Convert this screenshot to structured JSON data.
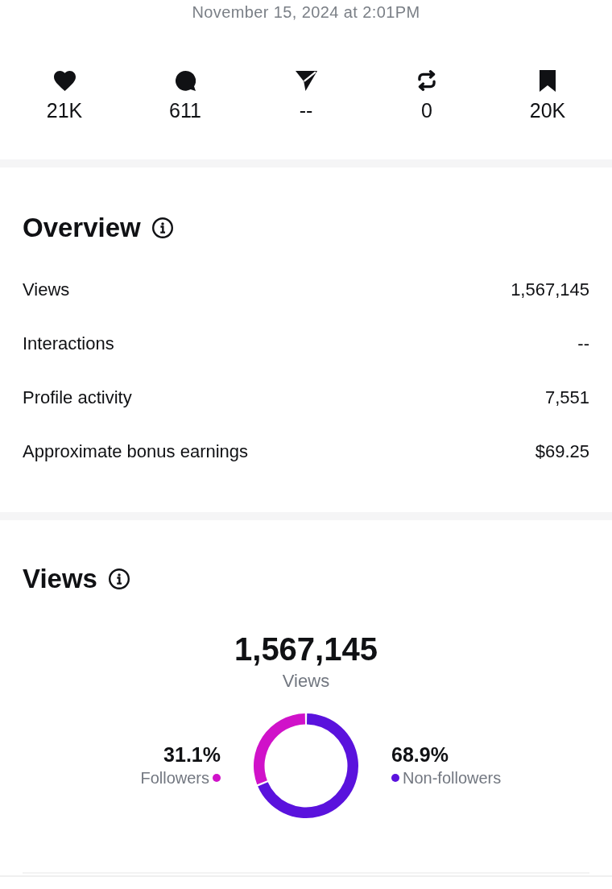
{
  "post": {
    "timestamp": "November 15, 2024 at 2:01PM"
  },
  "stats": [
    {
      "kind": "likes",
      "count": "21K"
    },
    {
      "kind": "replies",
      "count": "611"
    },
    {
      "kind": "shares",
      "count": "--"
    },
    {
      "kind": "reposts",
      "count": "0"
    },
    {
      "kind": "saves",
      "count": "20K"
    }
  ],
  "overview": {
    "title": "Overview",
    "rows": [
      {
        "label": "Views",
        "value": "1,567,145"
      },
      {
        "label": "Interactions",
        "value": "--"
      },
      {
        "label": "Profile activity",
        "value": "7,551"
      },
      {
        "label": "Approximate bonus earnings",
        "value": "$69.25"
      }
    ]
  },
  "views": {
    "title": "Views",
    "total": "1,567,145",
    "total_label": "Views",
    "chart_data": {
      "type": "donut",
      "categories": [
        "Followers",
        "Non-followers"
      ],
      "values": [
        31.1,
        68.9
      ],
      "value_labels": [
        "31.1%",
        "68.9%"
      ],
      "colors": [
        "#d012c9",
        "#5a12dd"
      ]
    }
  }
}
